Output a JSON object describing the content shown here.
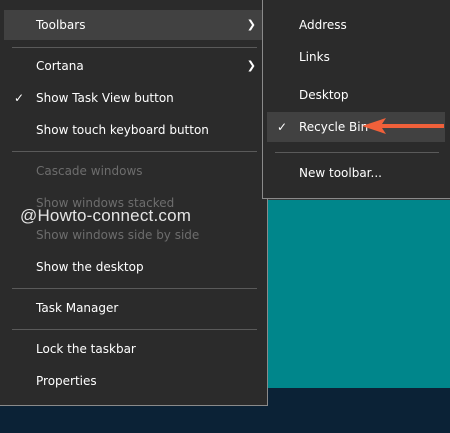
{
  "colors": {
    "menu_background": "#2b2b2b",
    "menu_border": "#8a8a8a",
    "highlight": "#414141",
    "disabled_text": "#6d6d6d",
    "desktop_teal": "#00868b",
    "taskbar": "#0b2236",
    "annotation_arrow": "#f0603a"
  },
  "icons": {
    "submenu": "chevron-right-icon",
    "checked": "checkmark-icon",
    "annotation": "arrow-left-icon"
  },
  "main_menu": {
    "toolbars": {
      "label": "Toolbars",
      "highlighted": true
    },
    "cortana": {
      "label": "Cortana"
    },
    "task_view": {
      "label": "Show Task View button",
      "checked": true
    },
    "touch_keyboard": {
      "label": "Show touch keyboard button"
    },
    "cascade": {
      "label": "Cascade windows",
      "disabled": true
    },
    "stacked": {
      "label": "Show windows stacked",
      "disabled": true
    },
    "side_by_side": {
      "label": "Show windows side by side",
      "disabled": true
    },
    "show_desktop": {
      "label": "Show the desktop"
    },
    "task_manager": {
      "label": "Task Manager"
    },
    "lock_taskbar": {
      "label": "Lock the taskbar"
    },
    "properties": {
      "label": "Properties"
    }
  },
  "submenu": {
    "address": {
      "label": "Address"
    },
    "links": {
      "label": "Links"
    },
    "desktop": {
      "label": "Desktop"
    },
    "recycle_bin": {
      "label": "Recycle Bin",
      "checked": true,
      "highlighted": true
    },
    "new_toolbar": {
      "label": "New toolbar..."
    }
  },
  "watermark": {
    "text": "@Howto-connect.com"
  },
  "glyphs": {
    "check": "✓",
    "chevron": "❯"
  }
}
